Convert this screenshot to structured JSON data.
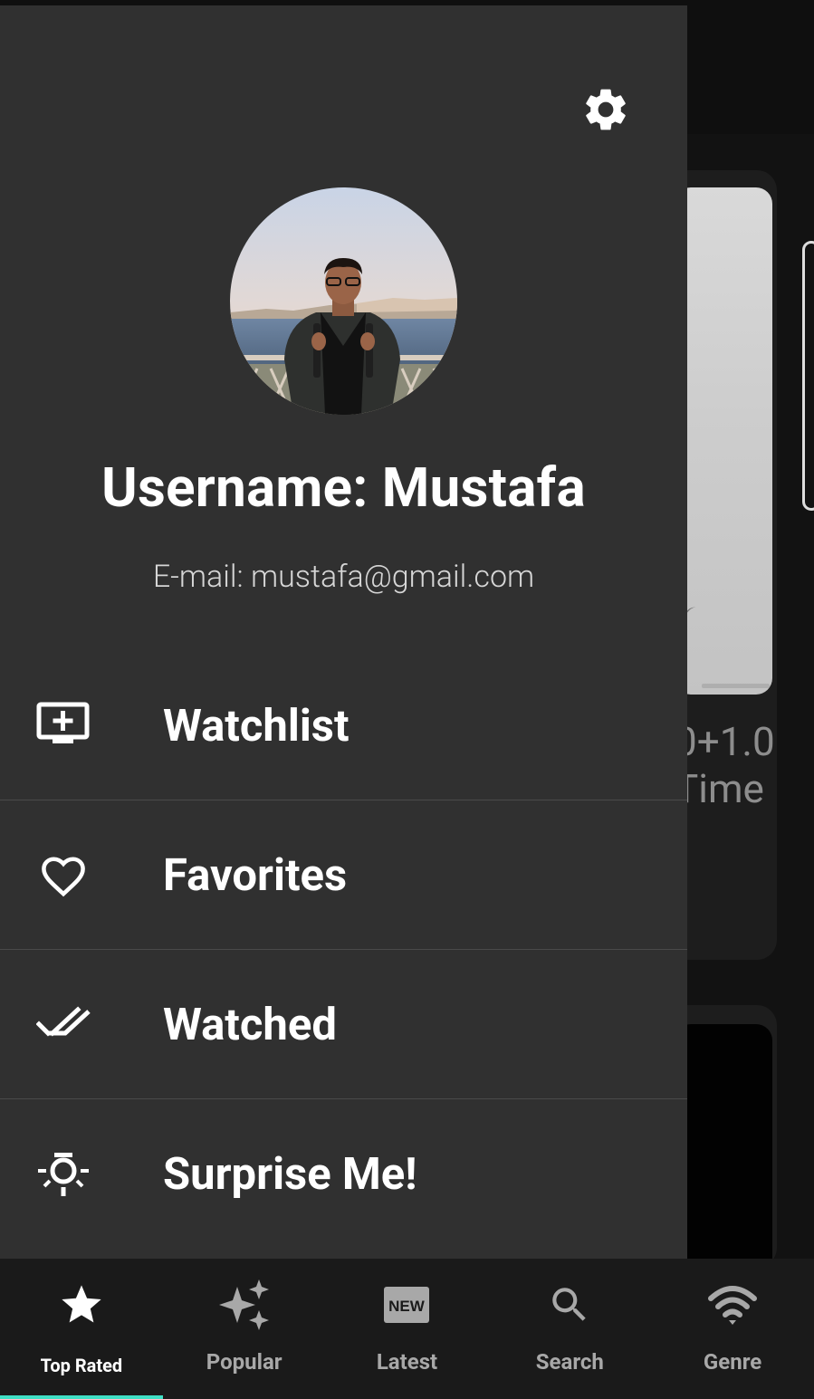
{
  "background": {
    "rating_text": "0+1.0",
    "subtitle_text": "Time"
  },
  "drawer": {
    "settings_icon": "gear-icon",
    "profile": {
      "username": "Username: Mustafa",
      "email": "E-mail: mustafa@gmail.com"
    },
    "menu": [
      {
        "label": "Watchlist",
        "icon": "tv-add-icon"
      },
      {
        "label": "Favorites",
        "icon": "heart-icon"
      },
      {
        "label": "Watched",
        "icon": "double-check-icon"
      },
      {
        "label": "Surprise Me!",
        "icon": "lightbulb-icon"
      }
    ]
  },
  "bottom_nav": {
    "active_index": 0,
    "accent_color": "#3fe0c5",
    "items": [
      {
        "label": "Top Rated",
        "icon": "star-icon"
      },
      {
        "label": "Popular",
        "icon": "sparkles-icon"
      },
      {
        "label": "Latest",
        "icon": "new-badge-icon"
      },
      {
        "label": "Search",
        "icon": "search-icon"
      },
      {
        "label": "Genre",
        "icon": "wifi-icon"
      }
    ]
  }
}
